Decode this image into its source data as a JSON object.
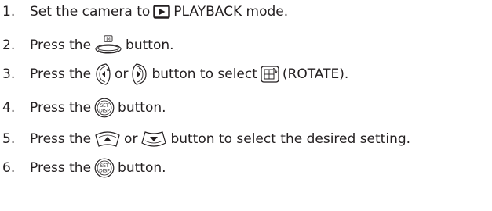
{
  "steps": [
    {
      "number": "1.",
      "text_a": "Set the camera to",
      "text_b": "PLAYBACK mode.",
      "icon": "playback-icon"
    },
    {
      "number": "2.",
      "text_a": "Press the",
      "text_b": "button.",
      "icon": "menu-button-icon",
      "icon_label": "M"
    },
    {
      "number": "3.",
      "text_a": "Press the",
      "text_b": "or",
      "text_c": "button to select",
      "text_d": "(ROTATE).",
      "icons": [
        "left-flash-button-icon",
        "right-button-icon",
        "rotate-icon"
      ]
    },
    {
      "number": "4.",
      "text_a": "Press the",
      "text_b": "button.",
      "icon": "set-disp-button-icon",
      "icon_label": [
        "SET",
        "DISP"
      ]
    },
    {
      "number": "5.",
      "text_a": "Press the",
      "text_b": "or",
      "text_c": "button to select the desired setting.",
      "icons": [
        "up-button-icon",
        "down-button-icon"
      ]
    },
    {
      "number": "6.",
      "text_a": "Press the",
      "text_b": "button.",
      "icon": "set-disp-button-icon",
      "icon_label": [
        "SET",
        "DISP"
      ]
    }
  ]
}
